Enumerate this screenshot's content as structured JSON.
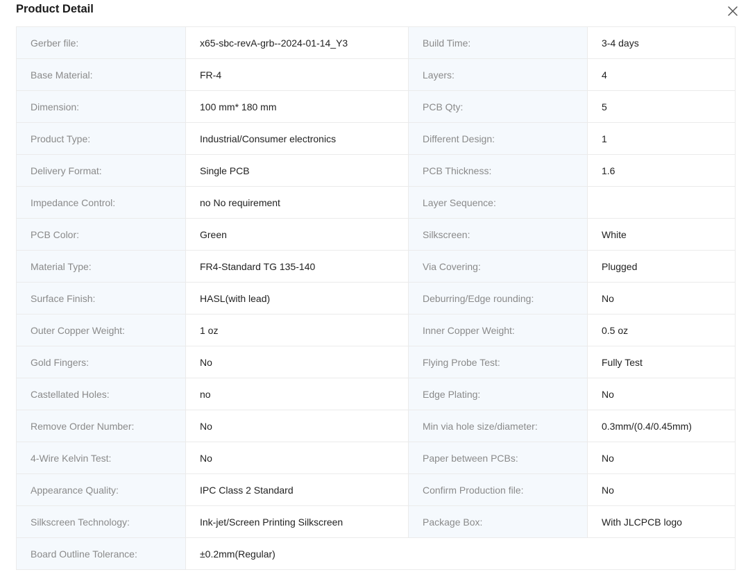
{
  "dialog": {
    "title": "Product Detail",
    "close_icon": "close-icon"
  },
  "rows": [
    [
      {
        "label": "Gerber file:",
        "value": "x65-sbc-revA-grb--2024-01-14_Y3"
      },
      {
        "label": "Build Time:",
        "value": "3-4 days"
      }
    ],
    [
      {
        "label": "Base Material:",
        "value": "FR-4"
      },
      {
        "label": "Layers:",
        "value": "4"
      }
    ],
    [
      {
        "label": "Dimension:",
        "value": "100 mm* 180 mm"
      },
      {
        "label": "PCB Qty:",
        "value": "5"
      }
    ],
    [
      {
        "label": "Product Type:",
        "value": "Industrial/Consumer electronics"
      },
      {
        "label": "Different Design:",
        "value": "1"
      }
    ],
    [
      {
        "label": "Delivery Format:",
        "value": "Single PCB"
      },
      {
        "label": "PCB Thickness:",
        "value": "1.6"
      }
    ],
    [
      {
        "label": "Impedance Control:",
        "value": "no No requirement"
      },
      {
        "label": "Layer Sequence:",
        "value": ""
      }
    ],
    [
      {
        "label": "PCB Color:",
        "value": "Green"
      },
      {
        "label": "Silkscreen:",
        "value": "White"
      }
    ],
    [
      {
        "label": "Material Type:",
        "value": "FR4-Standard TG 135-140"
      },
      {
        "label": "Via Covering:",
        "value": "Plugged"
      }
    ],
    [
      {
        "label": "Surface Finish:",
        "value": "HASL(with lead)"
      },
      {
        "label": "Deburring/Edge rounding:",
        "value": "No"
      }
    ],
    [
      {
        "label": "Outer Copper Weight:",
        "value": "1 oz"
      },
      {
        "label": "Inner Copper Weight:",
        "value": "0.5 oz"
      }
    ],
    [
      {
        "label": "Gold Fingers:",
        "value": "No"
      },
      {
        "label": "Flying Probe Test:",
        "value": "Fully Test"
      }
    ],
    [
      {
        "label": "Castellated Holes:",
        "value": "no"
      },
      {
        "label": "Edge Plating:",
        "value": "No"
      }
    ],
    [
      {
        "label": "Remove Order Number:",
        "value": "No"
      },
      {
        "label": "Min via hole size/diameter:",
        "value": "0.3mm/(0.4/0.45mm)"
      }
    ],
    [
      {
        "label": "4-Wire Kelvin Test:",
        "value": "No"
      },
      {
        "label": "Paper between PCBs:",
        "value": "No"
      }
    ],
    [
      {
        "label": "Appearance Quality:",
        "value": "IPC Class 2 Standard"
      },
      {
        "label": "Confirm Production file:",
        "value": "No"
      }
    ],
    [
      {
        "label": "Silkscreen Technology:",
        "value": "Ink-jet/Screen Printing Silkscreen"
      },
      {
        "label": "Package Box:",
        "value": "With JLCPCB logo"
      }
    ],
    [
      {
        "label": "Board Outline Tolerance:",
        "value": "±0.2mm(Regular)"
      }
    ]
  ]
}
